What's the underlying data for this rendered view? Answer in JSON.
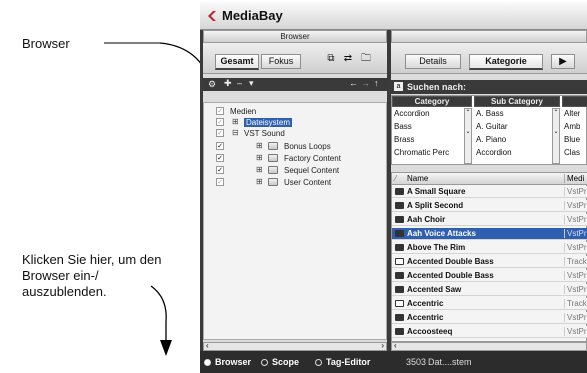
{
  "callouts": {
    "browser": "Browser",
    "toggle": "Klicken Sie hier, um den Browser ein-/ auszublenden."
  },
  "window": {
    "title": "MediaBay",
    "accent": "#c0282d"
  },
  "browser_panel": {
    "header": "Browser",
    "tabs": [
      "Gesamt",
      "Fokus"
    ],
    "tree": [
      {
        "label": "Medien",
        "checked": "✓",
        "dim": true
      },
      {
        "label": "Dateisystem",
        "checked": "✓",
        "dim": true,
        "selected": true
      },
      {
        "label": "VST Sound",
        "checked": "✓",
        "dim": true
      },
      {
        "label": "Bonus Loops",
        "checked": "✓",
        "dim": false
      },
      {
        "label": "Factory Content",
        "checked": "✓",
        "dim": false
      },
      {
        "label": "Sequel Content",
        "checked": "✓",
        "dim": false
      },
      {
        "label": "User Content",
        "checked": "✓",
        "dim": true
      }
    ]
  },
  "right_panel": {
    "tabs": [
      "Details",
      "Kategorie"
    ],
    "search_label": "Suchen nach:",
    "category_headers": [
      "Category",
      "Sub Category"
    ],
    "categories": [
      "Accordion",
      "Bass",
      "Brass",
      "Chromatic Perc"
    ],
    "subcategories": [
      "A. Bass",
      "A. Guitar",
      "A. Piano",
      "Accordion"
    ],
    "thirdcol": [
      "Alter",
      "Amb",
      "Blue",
      "Clas"
    ],
    "list_headers": [
      "Name",
      "Medi"
    ],
    "results": [
      {
        "name": "A Small Square",
        "media": "VstPr",
        "track": false
      },
      {
        "name": "A Split Second",
        "media": "VstPr",
        "track": false
      },
      {
        "name": "Aah Choir",
        "media": "VstPr",
        "track": false
      },
      {
        "name": "Aah Voice Attacks",
        "media": "VstPr",
        "track": false,
        "selected": true
      },
      {
        "name": "Above The Rim",
        "media": "VstPr",
        "track": false
      },
      {
        "name": "Accented Double Bass",
        "media": "Track",
        "track": true
      },
      {
        "name": "Accented Double Bass",
        "media": "VstPr",
        "track": false
      },
      {
        "name": "Accented Saw",
        "media": "VstPr",
        "track": false
      },
      {
        "name": "Accentric",
        "media": "Track",
        "track": true
      },
      {
        "name": "Accentric",
        "media": "VstPr",
        "track": false
      },
      {
        "name": "Accoosteeq",
        "media": "VstPr",
        "track": false
      }
    ]
  },
  "statusbar": {
    "options": [
      "Browser",
      "Scope",
      "Tag-Editor"
    ],
    "result_count": "3503",
    "path": "Dat....stem"
  }
}
